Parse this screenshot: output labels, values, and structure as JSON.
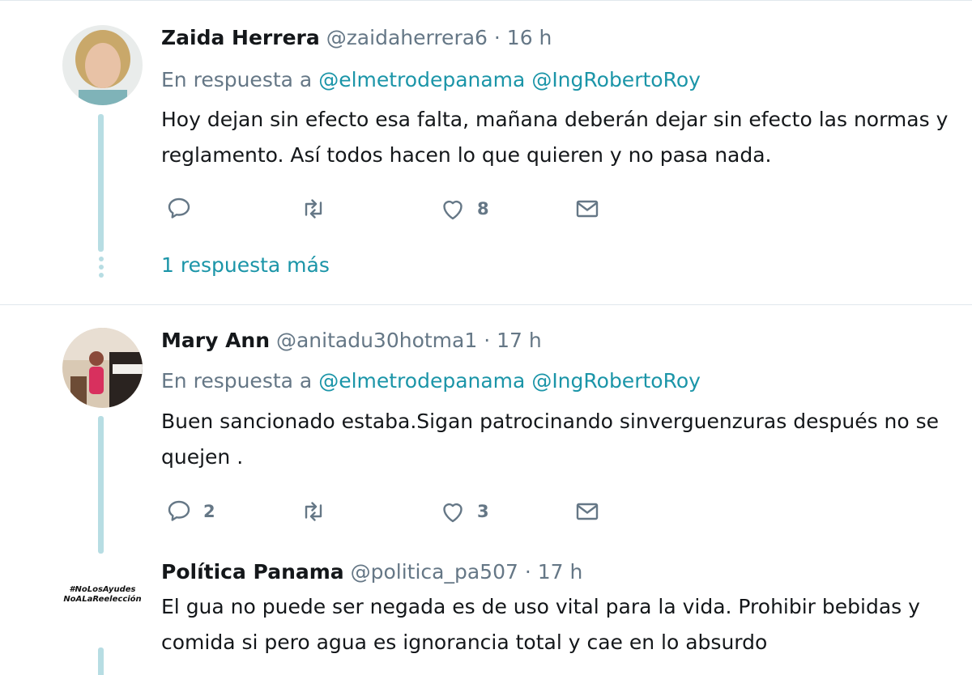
{
  "tweets": [
    {
      "name": "Zaida Herrera",
      "handle": "@zaidaherrera6",
      "sep": " · ",
      "time": "16 h",
      "reply_prefix": "En respuesta a ",
      "mention1": "@elmetrodepanama",
      "mention2": "@IngRobertoRoy",
      "text_line1": "Hoy dejan sin efecto esa falta, mañana deberán dejar sin efecto las normas y",
      "text_line2": "reglamento. Así todos hacen lo que quieren y no pasa nada.",
      "reply_count": "",
      "retweet_count": "",
      "like_count": "8",
      "more_replies": "1 respuesta más"
    },
    {
      "name": "Mary Ann",
      "handle": "@anitadu30hotma1",
      "sep": " · ",
      "time": "17 h",
      "reply_prefix": "En respuesta a ",
      "mention1": "@elmetrodepanama",
      "mention2": "@IngRobertoRoy",
      "text_line1": "Buen sancionado estaba.Sigan patrocinando sinverguenzuras después no se",
      "text_line2": "quejen .",
      "reply_count": "2",
      "retweet_count": "",
      "like_count": "3"
    },
    {
      "name": "Política Panama",
      "handle": "@politica_pa507",
      "sep": " · ",
      "time": "17 h",
      "avatar_line1": "#NoLosAyudes",
      "avatar_line2": "NoALaReelección",
      "text_line1": "El gua no puede ser negada es de uso vital para la vida. Prohibir bebidas y",
      "text_line2": "comida si pero agua es ignorancia total y cae en lo absurdo"
    }
  ],
  "icons": {
    "reply": "reply-icon",
    "retweet": "retweet-icon",
    "like": "heart-icon",
    "dm": "envelope-icon"
  },
  "colors": {
    "link": "#1b95a8",
    "secondary_text": "#657786",
    "thread_line": "#b7dde3"
  }
}
